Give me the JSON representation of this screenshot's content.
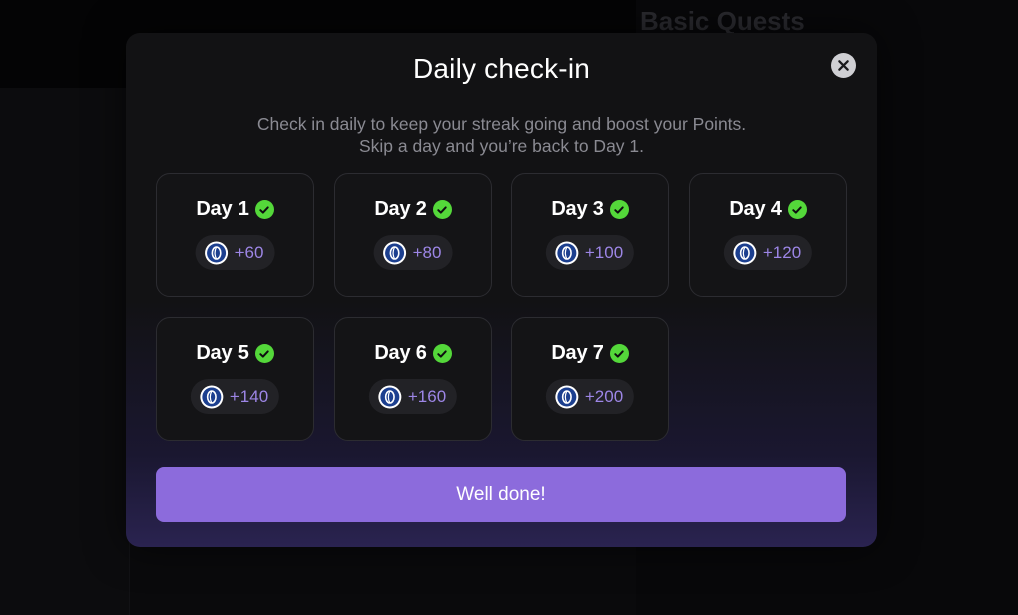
{
  "background": {
    "right_title": "Basic Quests"
  },
  "modal": {
    "title": "Daily check-in",
    "subtitle_line1": "Check in daily to keep your streak going and boost your Points.",
    "subtitle_line2": "Skip a day and you’re back to Day 1.",
    "close_icon": "close-icon",
    "days": [
      {
        "label": "Day 1",
        "reward": "+60",
        "checked": true
      },
      {
        "label": "Day 2",
        "reward": "+80",
        "checked": true
      },
      {
        "label": "Day 3",
        "reward": "+100",
        "checked": true
      },
      {
        "label": "Day 4",
        "reward": "+120",
        "checked": true
      },
      {
        "label": "Day 5",
        "reward": "+140",
        "checked": true
      },
      {
        "label": "Day 6",
        "reward": "+160",
        "checked": true
      },
      {
        "label": "Day 7",
        "reward": "+200",
        "checked": true
      }
    ],
    "button_label": "Well done!"
  },
  "colors": {
    "accent": "#8c6bdc",
    "reward_text": "#9d86e6",
    "check_green": "#54d83a",
    "coin_blue": "#1c3f8f"
  }
}
